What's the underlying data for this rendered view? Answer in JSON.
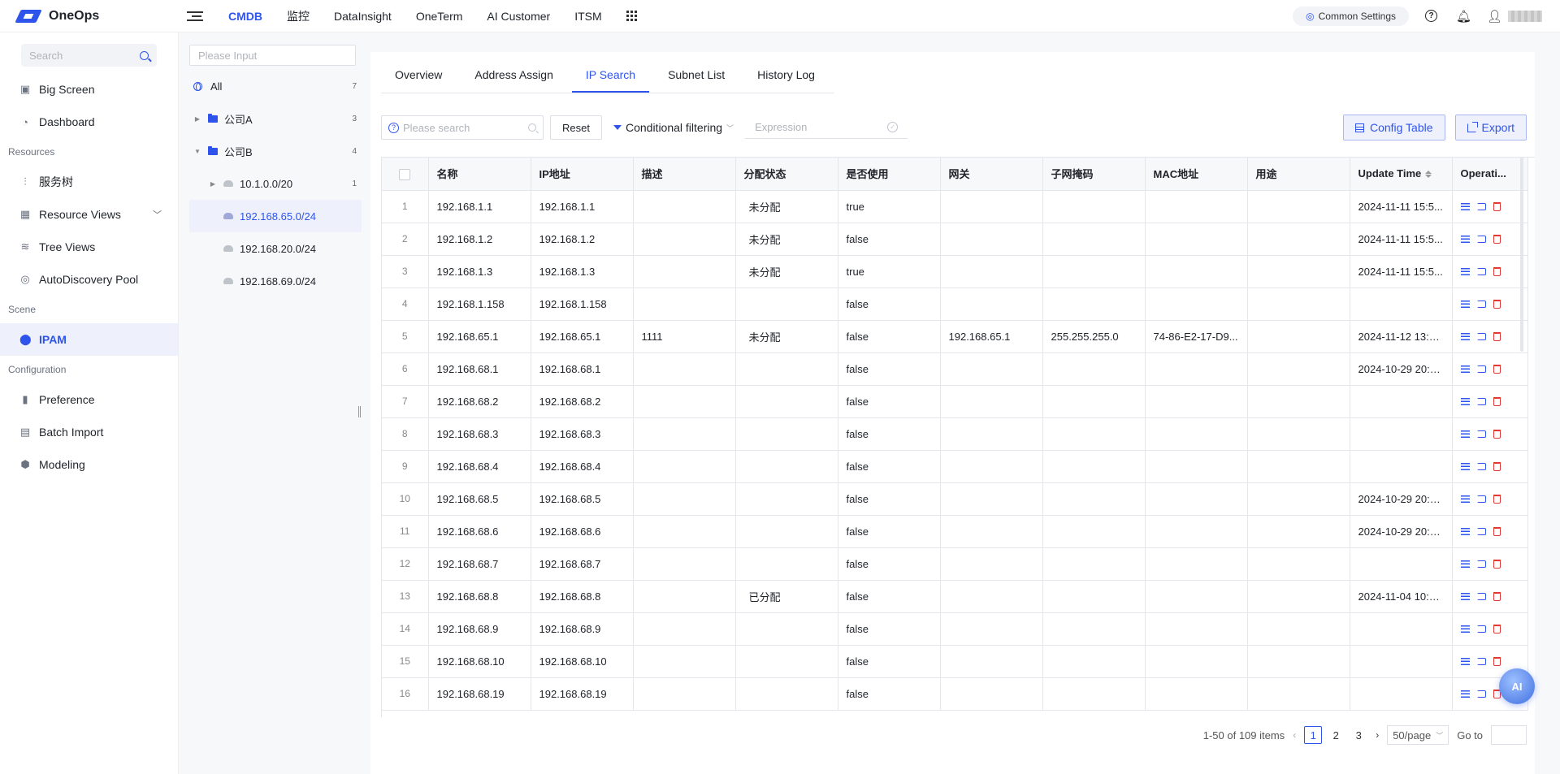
{
  "app": {
    "name": "OneOps"
  },
  "topnav": {
    "items": [
      "CMDB",
      "监控",
      "DataInsight",
      "OneTerm",
      "AI Customer",
      "ITSM"
    ],
    "active": "CMDB",
    "common_settings": "Common Settings"
  },
  "sidebar": {
    "search_placeholder": "Search",
    "top_items": [
      {
        "label": "Big Screen",
        "icon": "monitor-icon"
      },
      {
        "label": "Dashboard",
        "icon": "dashboard-icon"
      }
    ],
    "sections": {
      "resources": "Resources",
      "scene": "Scene",
      "configuration": "Configuration"
    },
    "resources_items": [
      {
        "label": "服务树",
        "icon": "service-tree-icon"
      },
      {
        "label": "Resource Views",
        "icon": "resource-views-icon"
      },
      {
        "label": "Tree Views",
        "icon": "tree-views-icon"
      },
      {
        "label": "AutoDiscovery Pool",
        "icon": "autodiscovery-icon"
      }
    ],
    "scene_items": [
      {
        "label": "IPAM",
        "icon": "location-pin-icon",
        "active": true
      }
    ],
    "configuration_items": [
      {
        "label": "Preference",
        "icon": "bookmark-icon"
      },
      {
        "label": "Batch Import",
        "icon": "import-icon"
      },
      {
        "label": "Modeling",
        "icon": "modeling-icon"
      }
    ]
  },
  "tree": {
    "input_placeholder": "Please Input",
    "nodes": [
      {
        "label": "All",
        "count": "7",
        "type": "globe",
        "level": 0
      },
      {
        "label": "公司A",
        "count": "3",
        "type": "folder",
        "level": 1,
        "caret": "collapsed"
      },
      {
        "label": "公司B",
        "count": "4",
        "type": "folder",
        "level": 1,
        "caret": "expanded"
      },
      {
        "label": "10.1.0.0/20",
        "count": "1",
        "type": "subnet",
        "level": 2,
        "caret": "collapsed"
      },
      {
        "label": "192.168.65.0/24",
        "count": "",
        "type": "subnet",
        "level": 2,
        "active": true
      },
      {
        "label": "192.168.20.0/24",
        "count": "",
        "type": "subnet",
        "level": 2
      },
      {
        "label": "192.168.69.0/24",
        "count": "",
        "type": "subnet",
        "level": 2
      }
    ]
  },
  "tabs": [
    "Overview",
    "Address Assign",
    "IP Search",
    "Subnet List",
    "History Log"
  ],
  "active_tab": "IP Search",
  "toolbar": {
    "search_placeholder": "Please search",
    "reset_label": "Reset",
    "conditional_filtering": "Conditional filtering",
    "expression_placeholder": "Expression",
    "config_table_label": "Config Table",
    "export_label": "Export"
  },
  "table": {
    "columns": [
      "名称",
      "IP地址",
      "描述",
      "分配状态",
      "是否使用",
      "网关",
      "子网掩码",
      "MAC地址",
      "用途",
      "Update Time",
      "Operati..."
    ],
    "rows": [
      [
        "1",
        "192.168.1.1",
        "192.168.1.1",
        "",
        "未分配",
        "true",
        "",
        "",
        "",
        "",
        "2024-11-11 15:5..."
      ],
      [
        "2",
        "192.168.1.2",
        "192.168.1.2",
        "",
        "未分配",
        "false",
        "",
        "",
        "",
        "",
        "2024-11-11 15:5..."
      ],
      [
        "3",
        "192.168.1.3",
        "192.168.1.3",
        "",
        "未分配",
        "true",
        "",
        "",
        "",
        "",
        "2024-11-11 15:5..."
      ],
      [
        "4",
        "192.168.1.158",
        "192.168.1.158",
        "",
        "",
        "false",
        "",
        "",
        "",
        "",
        ""
      ],
      [
        "5",
        "192.168.65.1",
        "192.168.65.1",
        "1111",
        "未分配",
        "false",
        "192.168.65.1",
        "255.255.255.0",
        "74-86-E2-17-D9...",
        "",
        "2024-11-12 13:3..."
      ],
      [
        "6",
        "192.168.68.1",
        "192.168.68.1",
        "",
        "",
        "false",
        "",
        "",
        "",
        "",
        "2024-10-29 20:3..."
      ],
      [
        "7",
        "192.168.68.2",
        "192.168.68.2",
        "",
        "",
        "false",
        "",
        "",
        "",
        "",
        ""
      ],
      [
        "8",
        "192.168.68.3",
        "192.168.68.3",
        "",
        "",
        "false",
        "",
        "",
        "",
        "",
        ""
      ],
      [
        "9",
        "192.168.68.4",
        "192.168.68.4",
        "",
        "",
        "false",
        "",
        "",
        "",
        "",
        ""
      ],
      [
        "10",
        "192.168.68.5",
        "192.168.68.5",
        "",
        "",
        "false",
        "",
        "",
        "",
        "",
        "2024-10-29 20:5..."
      ],
      [
        "11",
        "192.168.68.6",
        "192.168.68.6",
        "",
        "",
        "false",
        "",
        "",
        "",
        "",
        "2024-10-29 20:5..."
      ],
      [
        "12",
        "192.168.68.7",
        "192.168.68.7",
        "",
        "",
        "false",
        "",
        "",
        "",
        "",
        ""
      ],
      [
        "13",
        "192.168.68.8",
        "192.168.68.8",
        "",
        "已分配",
        "false",
        "",
        "",
        "",
        "",
        "2024-11-04 10:1..."
      ],
      [
        "14",
        "192.168.68.9",
        "192.168.68.9",
        "",
        "",
        "false",
        "",
        "",
        "",
        "",
        ""
      ],
      [
        "15",
        "192.168.68.10",
        "192.168.68.10",
        "",
        "",
        "false",
        "",
        "",
        "",
        "",
        ""
      ],
      [
        "16",
        "192.168.68.19",
        "192.168.68.19",
        "",
        "",
        "false",
        "",
        "",
        "",
        "",
        ""
      ]
    ]
  },
  "pagination": {
    "summary": "1-50 of 109 items",
    "pages": [
      "1",
      "2",
      "3"
    ],
    "current": "1",
    "page_size": "50/page",
    "goto_label": "Go to"
  },
  "ai_button": "AI",
  "colors": {
    "accent": "#2f54eb",
    "danger": "#e53935"
  }
}
